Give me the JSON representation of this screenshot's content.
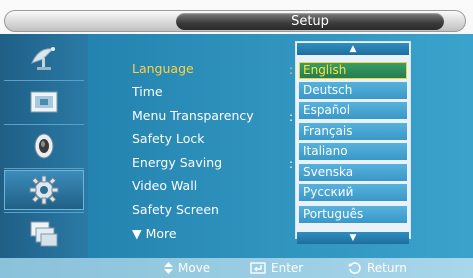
{
  "title": "Setup",
  "menu": {
    "items": [
      {
        "label": "Language"
      },
      {
        "label": "Time"
      },
      {
        "label": "Menu Transparency"
      },
      {
        "label": "Safety Lock"
      },
      {
        "label": "Energy Saving"
      },
      {
        "label": "Video Wall"
      },
      {
        "label": "Safety Screen"
      },
      {
        "label": "▼ More"
      }
    ],
    "selected_index": 0
  },
  "dropdown": {
    "scroll_up_glyph": "▲",
    "scroll_down_glyph": "▼",
    "options": [
      "English",
      "Deutsch",
      "Español",
      "Français",
      "Italiano",
      "Svenska",
      "Русский",
      "Português"
    ],
    "selected": "English"
  },
  "sidebar": {
    "icons": [
      "satellite-dish-icon",
      "picture-icon",
      "speaker-icon",
      "gear-icon",
      "multi-screen-icon"
    ],
    "active_index": 3
  },
  "footer": {
    "move": "Move",
    "enter": "Enter",
    "return": "Return"
  },
  "colors": {
    "panel": "#2c8fba",
    "highlight": "#ffd23d",
    "selected_option": "#237a4c"
  }
}
